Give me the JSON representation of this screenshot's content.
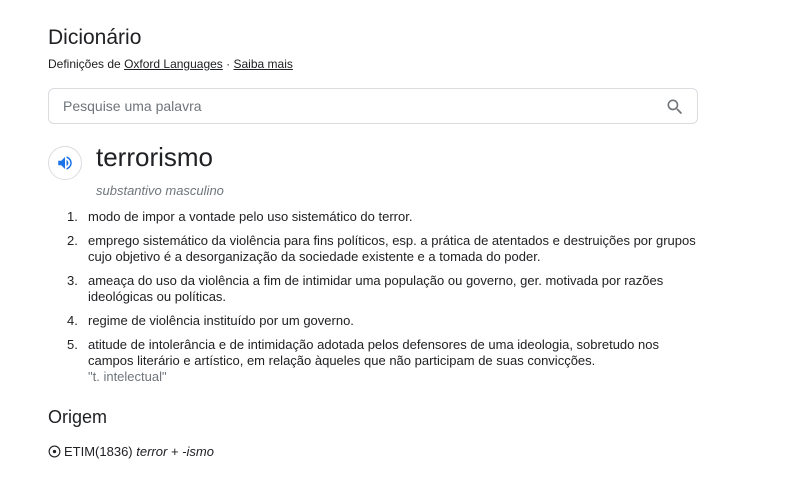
{
  "header": {
    "title": "Dicionário",
    "source_prefix": "Definições de",
    "source_link": "Oxford Languages",
    "separator": "·",
    "more_link": "Saiba mais"
  },
  "search": {
    "placeholder": "Pesquise uma palavra",
    "value": "",
    "icon": "search-icon"
  },
  "entry": {
    "speaker_icon": "speaker-icon",
    "word": "terrorismo",
    "part_of_speech": "substantivo masculino",
    "definitions": [
      {
        "number": "1.",
        "text": "modo de impor a vontade pelo uso sistemático do terror.",
        "example": ""
      },
      {
        "number": "2.",
        "text": "emprego sistemático da violência para fins políticos, esp. a prática de atentados e destruições por grupos cujo objetivo é a desorganização da sociedade existente e a tomada do poder.",
        "example": ""
      },
      {
        "number": "3.",
        "text": "ameaça do uso da violência a fim de intimidar uma população ou governo, ger. motivada por razões ideológicas ou políticas.",
        "example": ""
      },
      {
        "number": "4.",
        "text": "regime de violência instituído por um governo.",
        "example": ""
      },
      {
        "number": "5.",
        "text": "atitude de intolerância e de intimidação adotada pelos defensores de uma ideologia, sobretudo nos campos literário e artístico, em relação àqueles que não participam de suas convicções.",
        "example": "\"t. intelectual\""
      }
    ]
  },
  "origin": {
    "heading": "Origem",
    "icon": "expand-circle-icon",
    "prefix": "ETIM(1836)",
    "part1": "terror",
    "plus": "+",
    "part2": "-ismo"
  },
  "colors": {
    "text": "#202124",
    "muted": "#70757a",
    "border": "#dadce0",
    "speaker_blue": "#1a73e8"
  }
}
